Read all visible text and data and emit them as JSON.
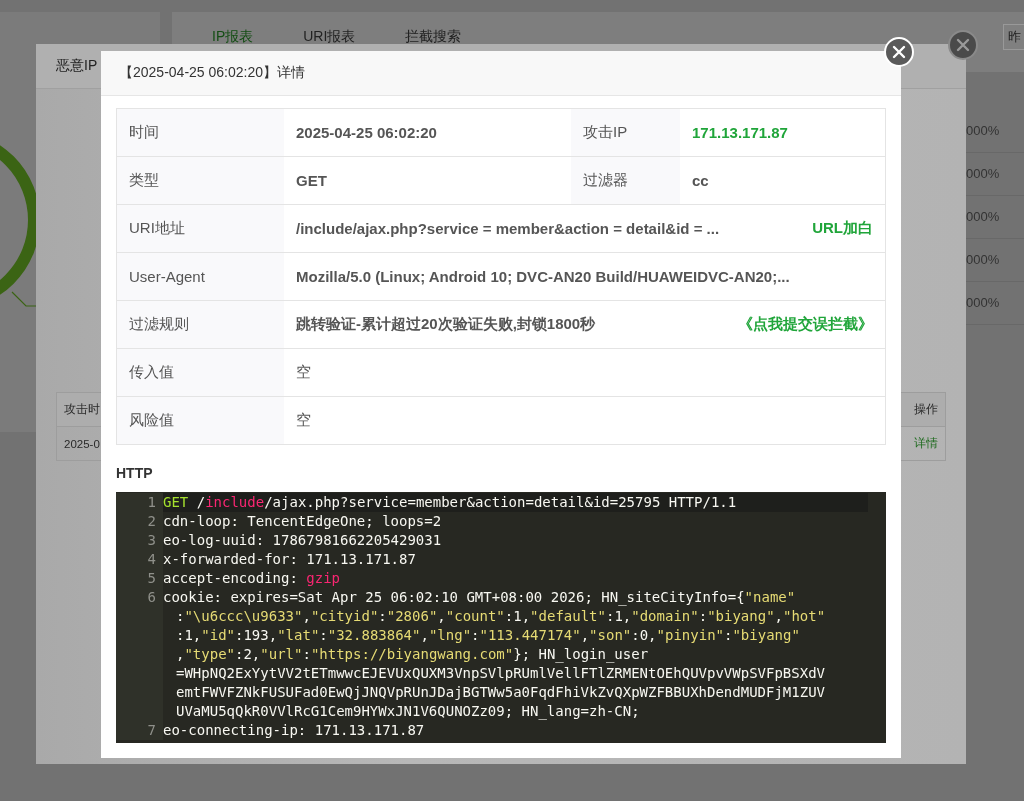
{
  "background_page": {
    "tabs": [
      {
        "label": "IP报表",
        "selected": true
      },
      {
        "label": "URI报表",
        "selected": false
      },
      {
        "label": "拦截搜索",
        "selected": false
      }
    ],
    "date_button": "昨",
    "percent_column": [
      "000%",
      "000%",
      "000%",
      "000%",
      "000%"
    ]
  },
  "malicious_ip_dialog": {
    "title": "恶意IP",
    "table": {
      "columns": [
        "攻击时",
        "操作"
      ],
      "rows": [
        {
          "cells": [
            "2025-0",
            "详情"
          ]
        }
      ]
    }
  },
  "detail_dialog": {
    "title": "【2025-04-25 06:02:20】详情",
    "info_rows": [
      {
        "label": "时间",
        "value": "2025-04-25 06:02:20",
        "bold": true,
        "highlighted": false,
        "pair": {
          "label": "攻击IP",
          "value": "171.13.171.87",
          "bold": true,
          "highlighted": true
        }
      },
      {
        "label": "类型",
        "value": "GET",
        "bold": true,
        "highlighted": false,
        "pair": {
          "label": "过滤器",
          "value": "cc",
          "bold": true,
          "highlighted": false
        }
      },
      {
        "label": "URI地址",
        "value": "/include/ajax.php?service = member&action = detail&id = ...",
        "bold": true,
        "highlighted": false,
        "link": "URL加白"
      },
      {
        "label": "User-Agent",
        "value": "Mozilla/5.0 (Linux; Android 10; DVC-AN20 Build/HUAWEIDVC-AN20;...",
        "bold": true,
        "highlighted": false
      },
      {
        "label": "过滤规则",
        "value": "跳转验证-累计超过20次验证失败,封锁1800秒",
        "bold": true,
        "highlighted": false,
        "link": "《点我提交误拦截》"
      },
      {
        "label": "传入值",
        "value": "空",
        "bold": false,
        "highlighted": false
      },
      {
        "label": "风险值",
        "value": "空",
        "bold": false,
        "highlighted": false
      }
    ],
    "http_label": "HTTP",
    "code_lines": [
      {
        "number": "1",
        "active": true,
        "rows": [
          {
            "segments": [
              {
                "text": "GET",
                "kind": "keyword"
              },
              {
                "text": " /",
                "kind": "plain"
              },
              {
                "text": "include",
                "kind": "tag"
              },
              {
                "text": "/ajax.php?service=member&action=detail&id=25795 HTTP/1.1",
                "kind": "plain"
              }
            ]
          }
        ]
      },
      {
        "number": "2",
        "active": false,
        "rows": [
          {
            "segments": [
              {
                "text": "cdn-loop: TencentEdgeOne; loops=2",
                "kind": "plain"
              }
            ]
          }
        ]
      },
      {
        "number": "3",
        "active": false,
        "rows": [
          {
            "segments": [
              {
                "text": "eo-log-uuid: 17867981662205429031",
                "kind": "plain"
              }
            ]
          }
        ]
      },
      {
        "number": "4",
        "active": false,
        "rows": [
          {
            "segments": [
              {
                "text": "x-forwarded-for: 171.13.171.87",
                "kind": "plain"
              }
            ]
          }
        ]
      },
      {
        "number": "5",
        "active": false,
        "rows": [
          {
            "segments": [
              {
                "text": "accept-encoding: ",
                "kind": "plain"
              },
              {
                "text": "gzip",
                "kind": "tag"
              }
            ]
          }
        ]
      },
      {
        "number": "6",
        "active": false,
        "rows": [
          {
            "segments": [
              {
                "text": "cookie: expires=Sat Apr 25 06:02:10 GMT+08:00 2026; HN_siteCityInfo={",
                "kind": "plain"
              },
              {
                "text": "\"name\"",
                "kind": "string"
              }
            ]
          },
          {
            "segments": [
              {
                "text": ":",
                "kind": "plain"
              },
              {
                "text": "\"\\u6ccc\\u9633\"",
                "kind": "string"
              },
              {
                "text": ",",
                "kind": "plain"
              },
              {
                "text": "\"cityid\"",
                "kind": "string"
              },
              {
                "text": ":",
                "kind": "plain"
              },
              {
                "text": "\"2806\"",
                "kind": "string"
              },
              {
                "text": ",",
                "kind": "plain"
              },
              {
                "text": "\"count\"",
                "kind": "string"
              },
              {
                "text": ":1,",
                "kind": "plain"
              },
              {
                "text": "\"default\"",
                "kind": "string"
              },
              {
                "text": ":1,",
                "kind": "plain"
              },
              {
                "text": "\"domain\"",
                "kind": "string"
              },
              {
                "text": ":",
                "kind": "plain"
              },
              {
                "text": "\"biyang\"",
                "kind": "string"
              },
              {
                "text": ",",
                "kind": "plain"
              },
              {
                "text": "\"hot\"",
                "kind": "string"
              }
            ]
          },
          {
            "segments": [
              {
                "text": ":1,",
                "kind": "plain"
              },
              {
                "text": "\"id\"",
                "kind": "string"
              },
              {
                "text": ":193,",
                "kind": "plain"
              },
              {
                "text": "\"lat\"",
                "kind": "string"
              },
              {
                "text": ":",
                "kind": "plain"
              },
              {
                "text": "\"32.883864\"",
                "kind": "string"
              },
              {
                "text": ",",
                "kind": "plain"
              },
              {
                "text": "\"lng\"",
                "kind": "string"
              },
              {
                "text": ":",
                "kind": "plain"
              },
              {
                "text": "\"113.447174\"",
                "kind": "string"
              },
              {
                "text": ",",
                "kind": "plain"
              },
              {
                "text": "\"son\"",
                "kind": "string"
              },
              {
                "text": ":0,",
                "kind": "plain"
              },
              {
                "text": "\"pinyin\"",
                "kind": "string"
              },
              {
                "text": ":",
                "kind": "plain"
              },
              {
                "text": "\"biyang\"",
                "kind": "string"
              }
            ]
          },
          {
            "segments": [
              {
                "text": ",",
                "kind": "plain"
              },
              {
                "text": "\"type\"",
                "kind": "string"
              },
              {
                "text": ":2,",
                "kind": "plain"
              },
              {
                "text": "\"url\"",
                "kind": "string"
              },
              {
                "text": ":",
                "kind": "plain"
              },
              {
                "text": "\"https://biyangwang.com\"",
                "kind": "string"
              },
              {
                "text": "}; HN_login_user",
                "kind": "plain"
              }
            ]
          },
          {
            "segments": [
              {
                "text": "=WHpNQ2ExYytVV2tETmwwcEJEVUxQUXM3VnpSVlpRUmlVellFTlZRMENtOEhQUVpvVWpSVFpBSXdV",
                "kind": "plain"
              }
            ]
          },
          {
            "segments": [
              {
                "text": "emtFWVFZNkFUSUFad0EwQjJNQVpRUnJDajBGTWw5a0FqdFhiVkZvQXpWZFBBUXhDendMUDFjM1ZUV",
                "kind": "plain"
              }
            ]
          },
          {
            "segments": [
              {
                "text": "UVaMU5qQkR0VVlRcG1Cem9HYWxJN1V6QUNOZz09; HN_lang=zh-CN;",
                "kind": "plain"
              }
            ]
          }
        ]
      },
      {
        "number": "7",
        "active": false,
        "rows": [
          {
            "segments": [
              {
                "text": "eo-connecting-ip: 171.13.171.87",
                "kind": "plain"
              }
            ]
          }
        ]
      }
    ]
  }
}
